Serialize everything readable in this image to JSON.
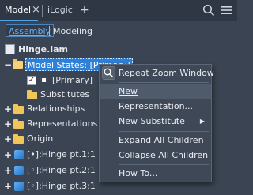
{
  "tabs": {
    "model": {
      "label": "Model",
      "close": "×"
    },
    "ilogic": {
      "label": "iLogic"
    },
    "add": "+"
  },
  "toolbar": {
    "search_icon": "search-icon",
    "menu_icon": "hamburger-menu-icon"
  },
  "subtabs": {
    "assembly": "Assembly",
    "modeling": "Modeling"
  },
  "tree": {
    "root": "Hinge.iam",
    "model_states": "Model States: [Primary]",
    "primary": "[Primary]",
    "substitutes": "Substitutes",
    "relationships": "Relationships",
    "representations": "Representations",
    "origin": "Origin",
    "parts": [
      "[•]:Hinge pt.1:1",
      "[◦]:Hinge pt.2:1",
      "[◦]:Hinge pt.3:1"
    ]
  },
  "context_menu": {
    "repeat_zoom": "Repeat Zoom Window",
    "new": "New",
    "representation": "Representation...",
    "new_substitute": "New Substitute",
    "expand_all": "Expand All Children",
    "collapse_all": "Collapse All Children",
    "how_to": "How To..."
  },
  "colors": {
    "accent": "#4da3e8",
    "selection": "#2e7fd6",
    "background": "#3b4453"
  }
}
